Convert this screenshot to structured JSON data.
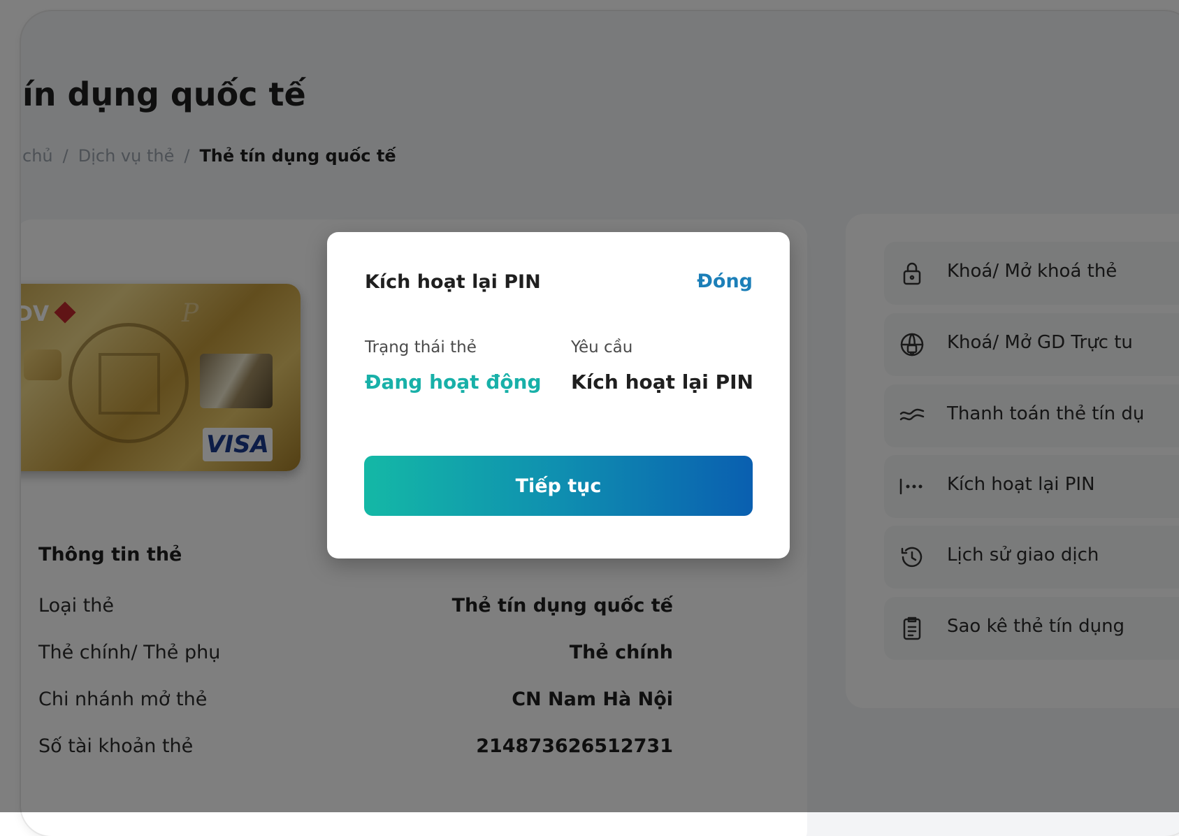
{
  "page": {
    "title": "ín dụng quốc tế",
    "breadcrumb": {
      "home": "chủ",
      "services": "Dịch vụ thẻ",
      "current": "Thẻ tín dụng quốc tế",
      "separator": "/"
    }
  },
  "card": {
    "brand": "DV",
    "network": "VISA"
  },
  "card_info": {
    "title": "Thông tin thẻ",
    "rows": [
      {
        "label": "Loại thẻ",
        "value": "Thẻ tín dụng quốc tế"
      },
      {
        "label": "Thẻ chính/ Thẻ phụ",
        "value": "Thẻ chính"
      },
      {
        "label": "Chi nhánh mở thẻ",
        "value": "CN Nam Hà Nội"
      },
      {
        "label": "Số tài khoản thẻ",
        "value": "214873626512731"
      }
    ]
  },
  "actions": [
    {
      "label": "Khoá/ Mở khoá thẻ",
      "icon": "lock-icon"
    },
    {
      "label": "Khoá/ Mở GD Trực tu",
      "icon": "globe-lock-icon"
    },
    {
      "label": "Thanh toán thẻ tín dụ",
      "icon": "payment-wave-icon"
    },
    {
      "label": "Kích hoạt lại PIN",
      "icon": "pin-dots-icon"
    },
    {
      "label": "Lịch sử giao dịch",
      "icon": "history-icon"
    },
    {
      "label": "Sao kê thẻ tín dụng",
      "icon": "clipboard-list-icon"
    }
  ],
  "modal": {
    "title": "Kích hoạt lại PIN",
    "close_label": "Đóng",
    "status_label": "Trạng thái thẻ",
    "status_value": "Đang hoạt động",
    "request_label": "Yêu cầu",
    "request_value": "Kích hoạt lại PIN",
    "continue_label": "Tiếp tục"
  },
  "colors": {
    "accent": "#1c7fb8",
    "status_active": "#18b0a8",
    "button_gradient_start": "#14b8a6",
    "button_gradient_end": "#0a5fb0"
  }
}
